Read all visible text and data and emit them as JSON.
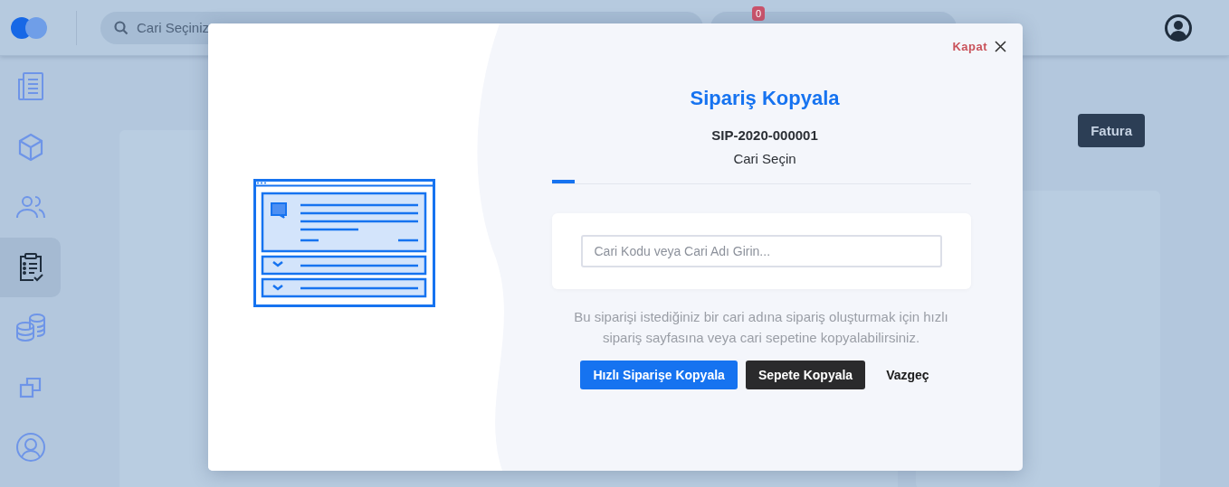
{
  "topbar": {
    "search": {
      "placeholder": "Cari Seçiniz"
    },
    "cart": {
      "badge": "0"
    }
  },
  "sidebar": {
    "items": [
      {
        "kind": "document",
        "selected": false
      },
      {
        "kind": "box",
        "selected": false
      },
      {
        "kind": "users",
        "selected": false
      },
      {
        "kind": "clipboard",
        "selected": true
      },
      {
        "kind": "coins",
        "selected": false
      },
      {
        "kind": "copy",
        "selected": false
      },
      {
        "kind": "user",
        "selected": false
      }
    ]
  },
  "background": {
    "invoice_button": "Fatura"
  },
  "modal": {
    "close_label": "Kapat",
    "title": "Sipariş Kopyala",
    "order_number": "SIP-2020-000001",
    "step_title": "Cari Seçin",
    "step_progress": {
      "level": 0.055
    },
    "search": {
      "placeholder": "Cari Kodu veya Cari Adı Girin..."
    },
    "description": "Bu siparişi istediğiniz bir cari adına sipariş oluşturmak için hızlı sipariş sayfasına veya cari sepetine kopyalabilirsiniz.",
    "buttons": [
      {
        "label": "Hızlı Siparişe Kopyala",
        "kind": "primary"
      },
      {
        "label": "Sepete Kopyala",
        "kind": "dark"
      },
      {
        "label": "Vazgeç",
        "kind": "plain"
      }
    ]
  }
}
